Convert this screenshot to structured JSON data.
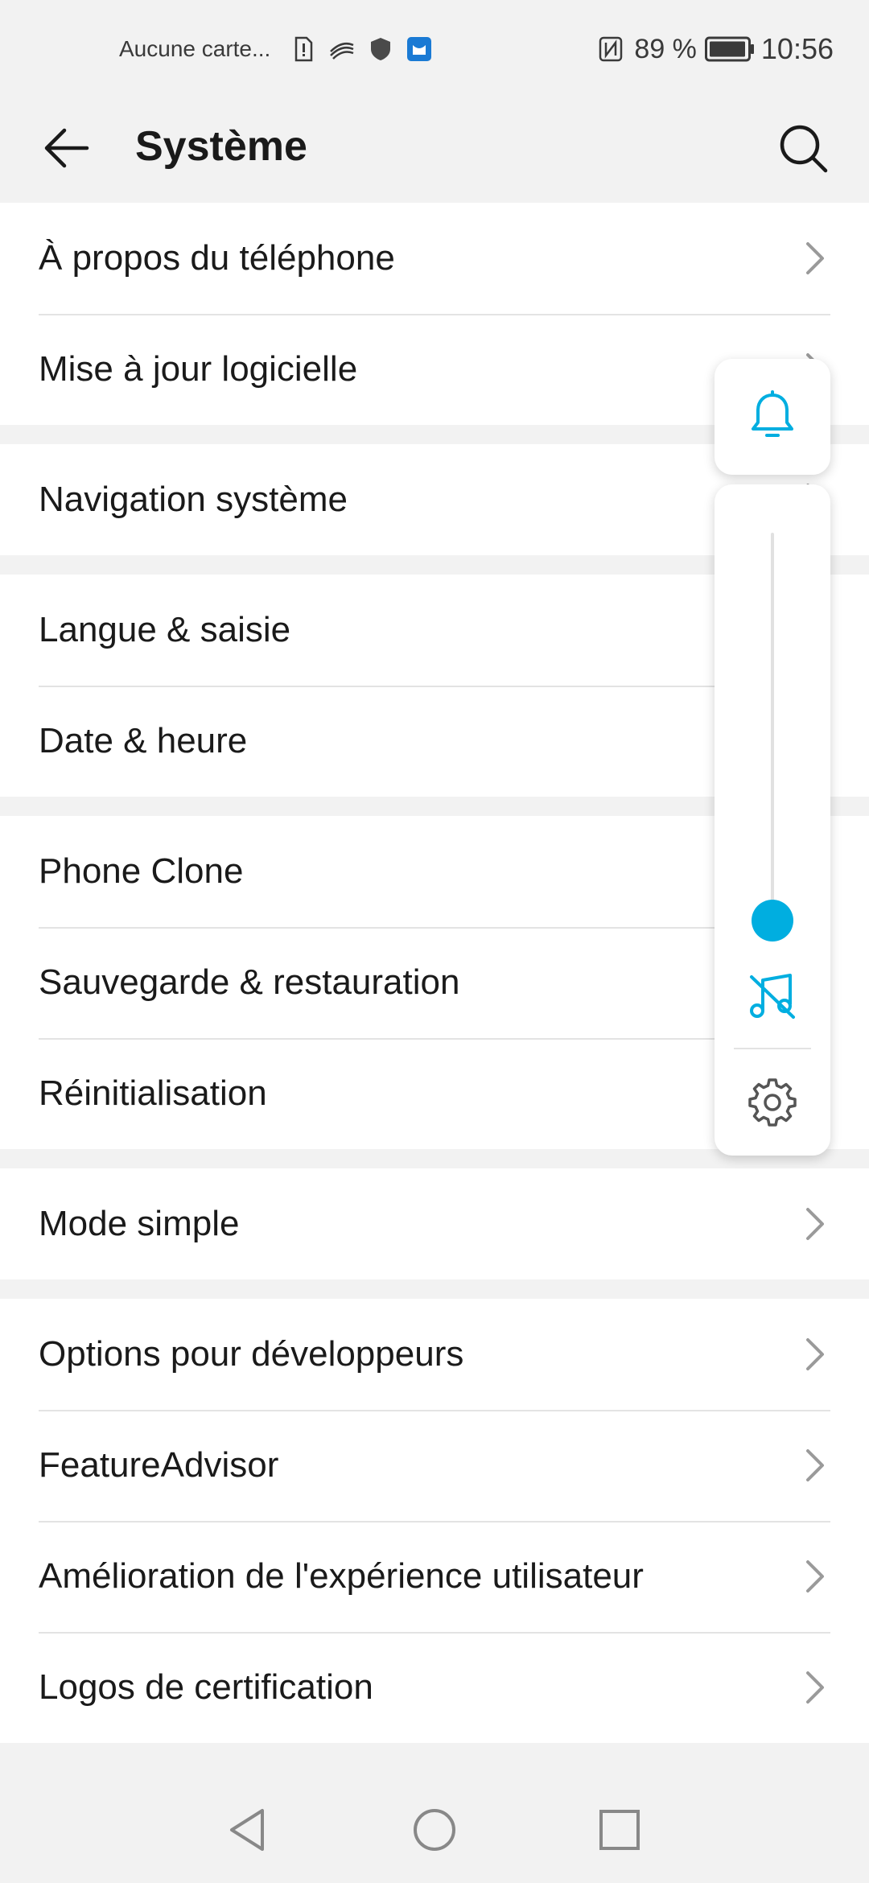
{
  "status": {
    "carrier": "Aucune carte...",
    "battery_pct": "89 %",
    "time": "10:56"
  },
  "appbar": {
    "title": "Système"
  },
  "groups": [
    {
      "items": [
        "À propos du téléphone",
        "Mise à jour logicielle"
      ]
    },
    {
      "items": [
        "Navigation système"
      ]
    },
    {
      "items": [
        "Langue & saisie",
        "Date & heure"
      ]
    },
    {
      "items": [
        "Phone Clone",
        "Sauvegarde & restauration",
        "Réinitialisation"
      ]
    },
    {
      "items": [
        "Mode simple"
      ]
    },
    {
      "items": [
        "Options pour développeurs",
        "FeatureAdvisor",
        "Amélioration de l'expérience utilisateur",
        "Logos de certification"
      ]
    }
  ],
  "colors": {
    "accent": "#00aee0",
    "background": "#f2f2f2",
    "card": "#ffffff"
  },
  "volume": {
    "level": 0,
    "icons": [
      "bell-icon",
      "music-mute-icon",
      "gear-icon"
    ]
  }
}
